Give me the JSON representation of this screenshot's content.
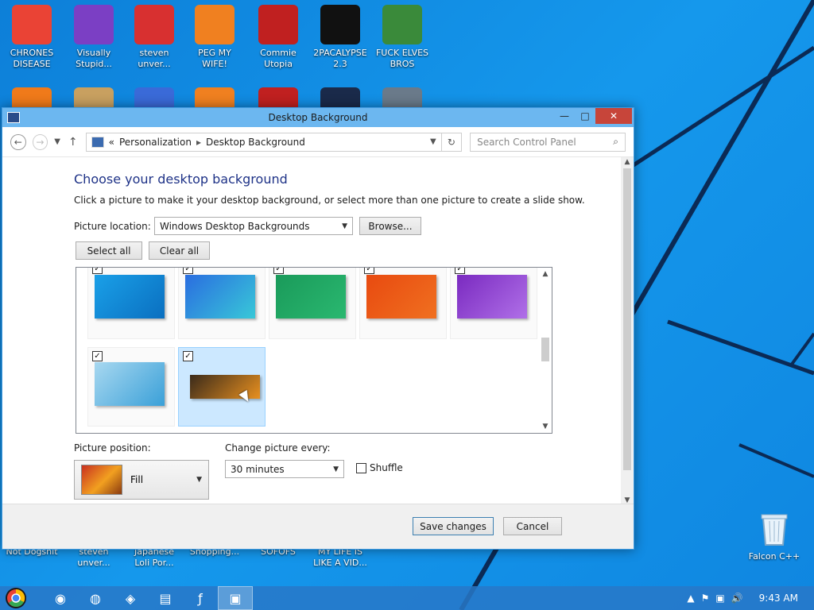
{
  "desktop": {
    "top_icons": [
      {
        "label": "CHRONES\nDISEASE",
        "icon": "chrome-icon",
        "color": "#ea4335"
      },
      {
        "label": "Visually\nStupid...",
        "icon": "visual-studio-icon",
        "color": "#7b3fc4"
      },
      {
        "label": "steven\nunver...",
        "icon": "steven-universe-icon",
        "color": "#d83030"
      },
      {
        "label": "PEG MY WIFE!",
        "icon": "peggle-icon",
        "color": "#f08020"
      },
      {
        "label": "Commie\nUtopia",
        "icon": "commie-utopia-icon",
        "color": "#c02020"
      },
      {
        "label": "2PACALYPSE\n2.3",
        "icon": "cmd-icon",
        "color": "#111111"
      },
      {
        "label": "FUCK ELVES\nBROS",
        "icon": "elf-icon",
        "color": "#3a8a3a"
      }
    ],
    "bottom_labels": [
      "Not Dogshit",
      "steven\nunver...",
      "Japanese\nLoli Por...",
      "Shopping...",
      "SOFOFS",
      "MY LIFE IS\nLIKE A VID..."
    ],
    "recycle_bin": {
      "label": "Falcon C++",
      "icon": "recycle-bin-icon"
    }
  },
  "window": {
    "title": "Desktop Background",
    "buttons": {
      "minimize": "—",
      "maximize": "□",
      "close": "✕"
    },
    "nav": {
      "back_icon": "back-arrow-icon",
      "forward_icon": "forward-arrow-icon",
      "up_icon": "up-arrow-icon",
      "breadcrumb_prefix": "«",
      "breadcrumbs": [
        "Personalization",
        "Desktop Background"
      ],
      "search_placeholder": "Search Control Panel"
    },
    "heading": "Choose your desktop background",
    "description": "Click a picture to make it your desktop background, or select more than one picture to create a slide show.",
    "picture_location_label": "Picture location:",
    "picture_location_value": "Windows Desktop Backgrounds",
    "browse_label": "Browse...",
    "select_all_label": "Select all",
    "clear_all_label": "Clear all",
    "pictures": [
      {
        "checked": true,
        "selected": false,
        "colors": [
          "#1aa0e8",
          "#0a6fc0"
        ]
      },
      {
        "checked": true,
        "selected": false,
        "colors": [
          "#2a6de0",
          "#38c8d8"
        ]
      },
      {
        "checked": true,
        "selected": false,
        "colors": [
          "#1a9a5a",
          "#2ab870"
        ]
      },
      {
        "checked": true,
        "selected": false,
        "colors": [
          "#e84a10",
          "#f07020"
        ]
      },
      {
        "checked": true,
        "selected": false,
        "colors": [
          "#7a2ac0",
          "#b070e8"
        ]
      },
      {
        "checked": true,
        "selected": false,
        "colors": [
          "#a8d8f0",
          "#3aa0d8"
        ]
      },
      {
        "checked": true,
        "selected": true,
        "colors": [
          "#3a2a1a",
          "#e89020"
        ]
      }
    ],
    "picture_position_label": "Picture position:",
    "picture_position_value": "Fill",
    "change_every_label": "Change picture every:",
    "change_every_value": "30 minutes",
    "shuffle_label": "Shuffle",
    "shuffle_checked": false,
    "save_label": "Save changes",
    "cancel_label": "Cancel"
  },
  "taskbar": {
    "apps": [
      "chrome-icon",
      "firefox-icon",
      "network-icon",
      "file-explorer-icon",
      "flash-icon",
      "control-panel-icon"
    ],
    "active_index": 5,
    "clock": "9:43 AM"
  }
}
